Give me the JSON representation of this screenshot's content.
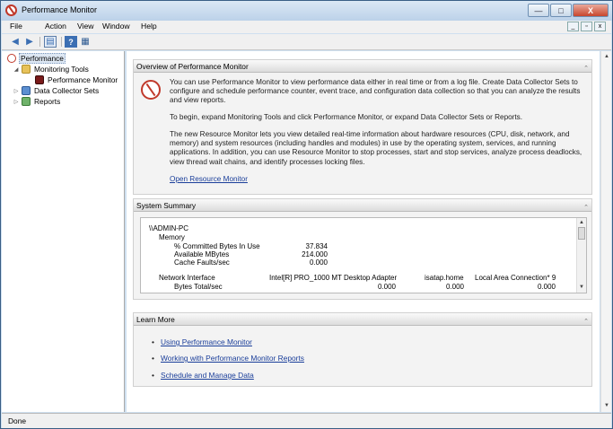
{
  "window": {
    "title": "Performance Monitor",
    "minimize": "—",
    "maximize": "□",
    "close": "X"
  },
  "menu": [
    "File",
    "Action",
    "View",
    "Window",
    "Help"
  ],
  "mdi": {
    "minimize": "_",
    "restore": "▫",
    "close": "x"
  },
  "toolbar": {
    "back_icon": "back-arrow-icon",
    "forward_icon": "forward-arrow-icon",
    "console_icon": "show-hide-console-tree-icon",
    "help_icon": "help-icon",
    "properties_icon": "properties-icon"
  },
  "tree": {
    "root": "Performance",
    "monitoring_tools": "Monitoring Tools",
    "performance_monitor": "Performance Monitor",
    "data_collector_sets": "Data Collector Sets",
    "reports": "Reports"
  },
  "overview": {
    "header": "Overview of Performance Monitor",
    "p1": "You can use Performance Monitor to view performance data either in real time or from a log file. Create Data Collector Sets to configure and schedule performance counter, event trace, and configuration data collection so that you can analyze the results and view reports.",
    "p2": "To begin, expand Monitoring Tools and click Performance Monitor, or expand Data Collector Sets or Reports.",
    "p3": "The new Resource Monitor lets you view detailed real-time information about hardware resources (CPU, disk, network, and memory) and system resources (including handles and modules) in use by the operating system, services, and running applications. In addition, you can use Resource Monitor to stop processes, start and stop services, analyze process deadlocks, view thread wait chains, and identify processes locking files.",
    "link": "Open Resource Monitor"
  },
  "summary": {
    "header": "System Summary",
    "machine": "\\\\ADMIN-PC",
    "memory_label": "Memory",
    "counters": [
      {
        "name": "% Committed Bytes In Use",
        "value": "37.834"
      },
      {
        "name": "Available MBytes",
        "value": "214.000"
      },
      {
        "name": "Cache Faults/sec",
        "value": "0.000"
      }
    ],
    "network_label": "Network Interface",
    "adapters": [
      "Intel[R] PRO_1000 MT Desktop Adapter",
      "isatap.home",
      "Local Area Connection* 9"
    ],
    "bytes_label": "Bytes Total/sec",
    "bytes_values": [
      "0.000",
      "0.000",
      "0.000"
    ]
  },
  "learn": {
    "header": "Learn More",
    "items": [
      "Using Performance Monitor",
      "Working with Performance Monitor Reports",
      "Schedule and Manage Data"
    ]
  },
  "status": "Done"
}
